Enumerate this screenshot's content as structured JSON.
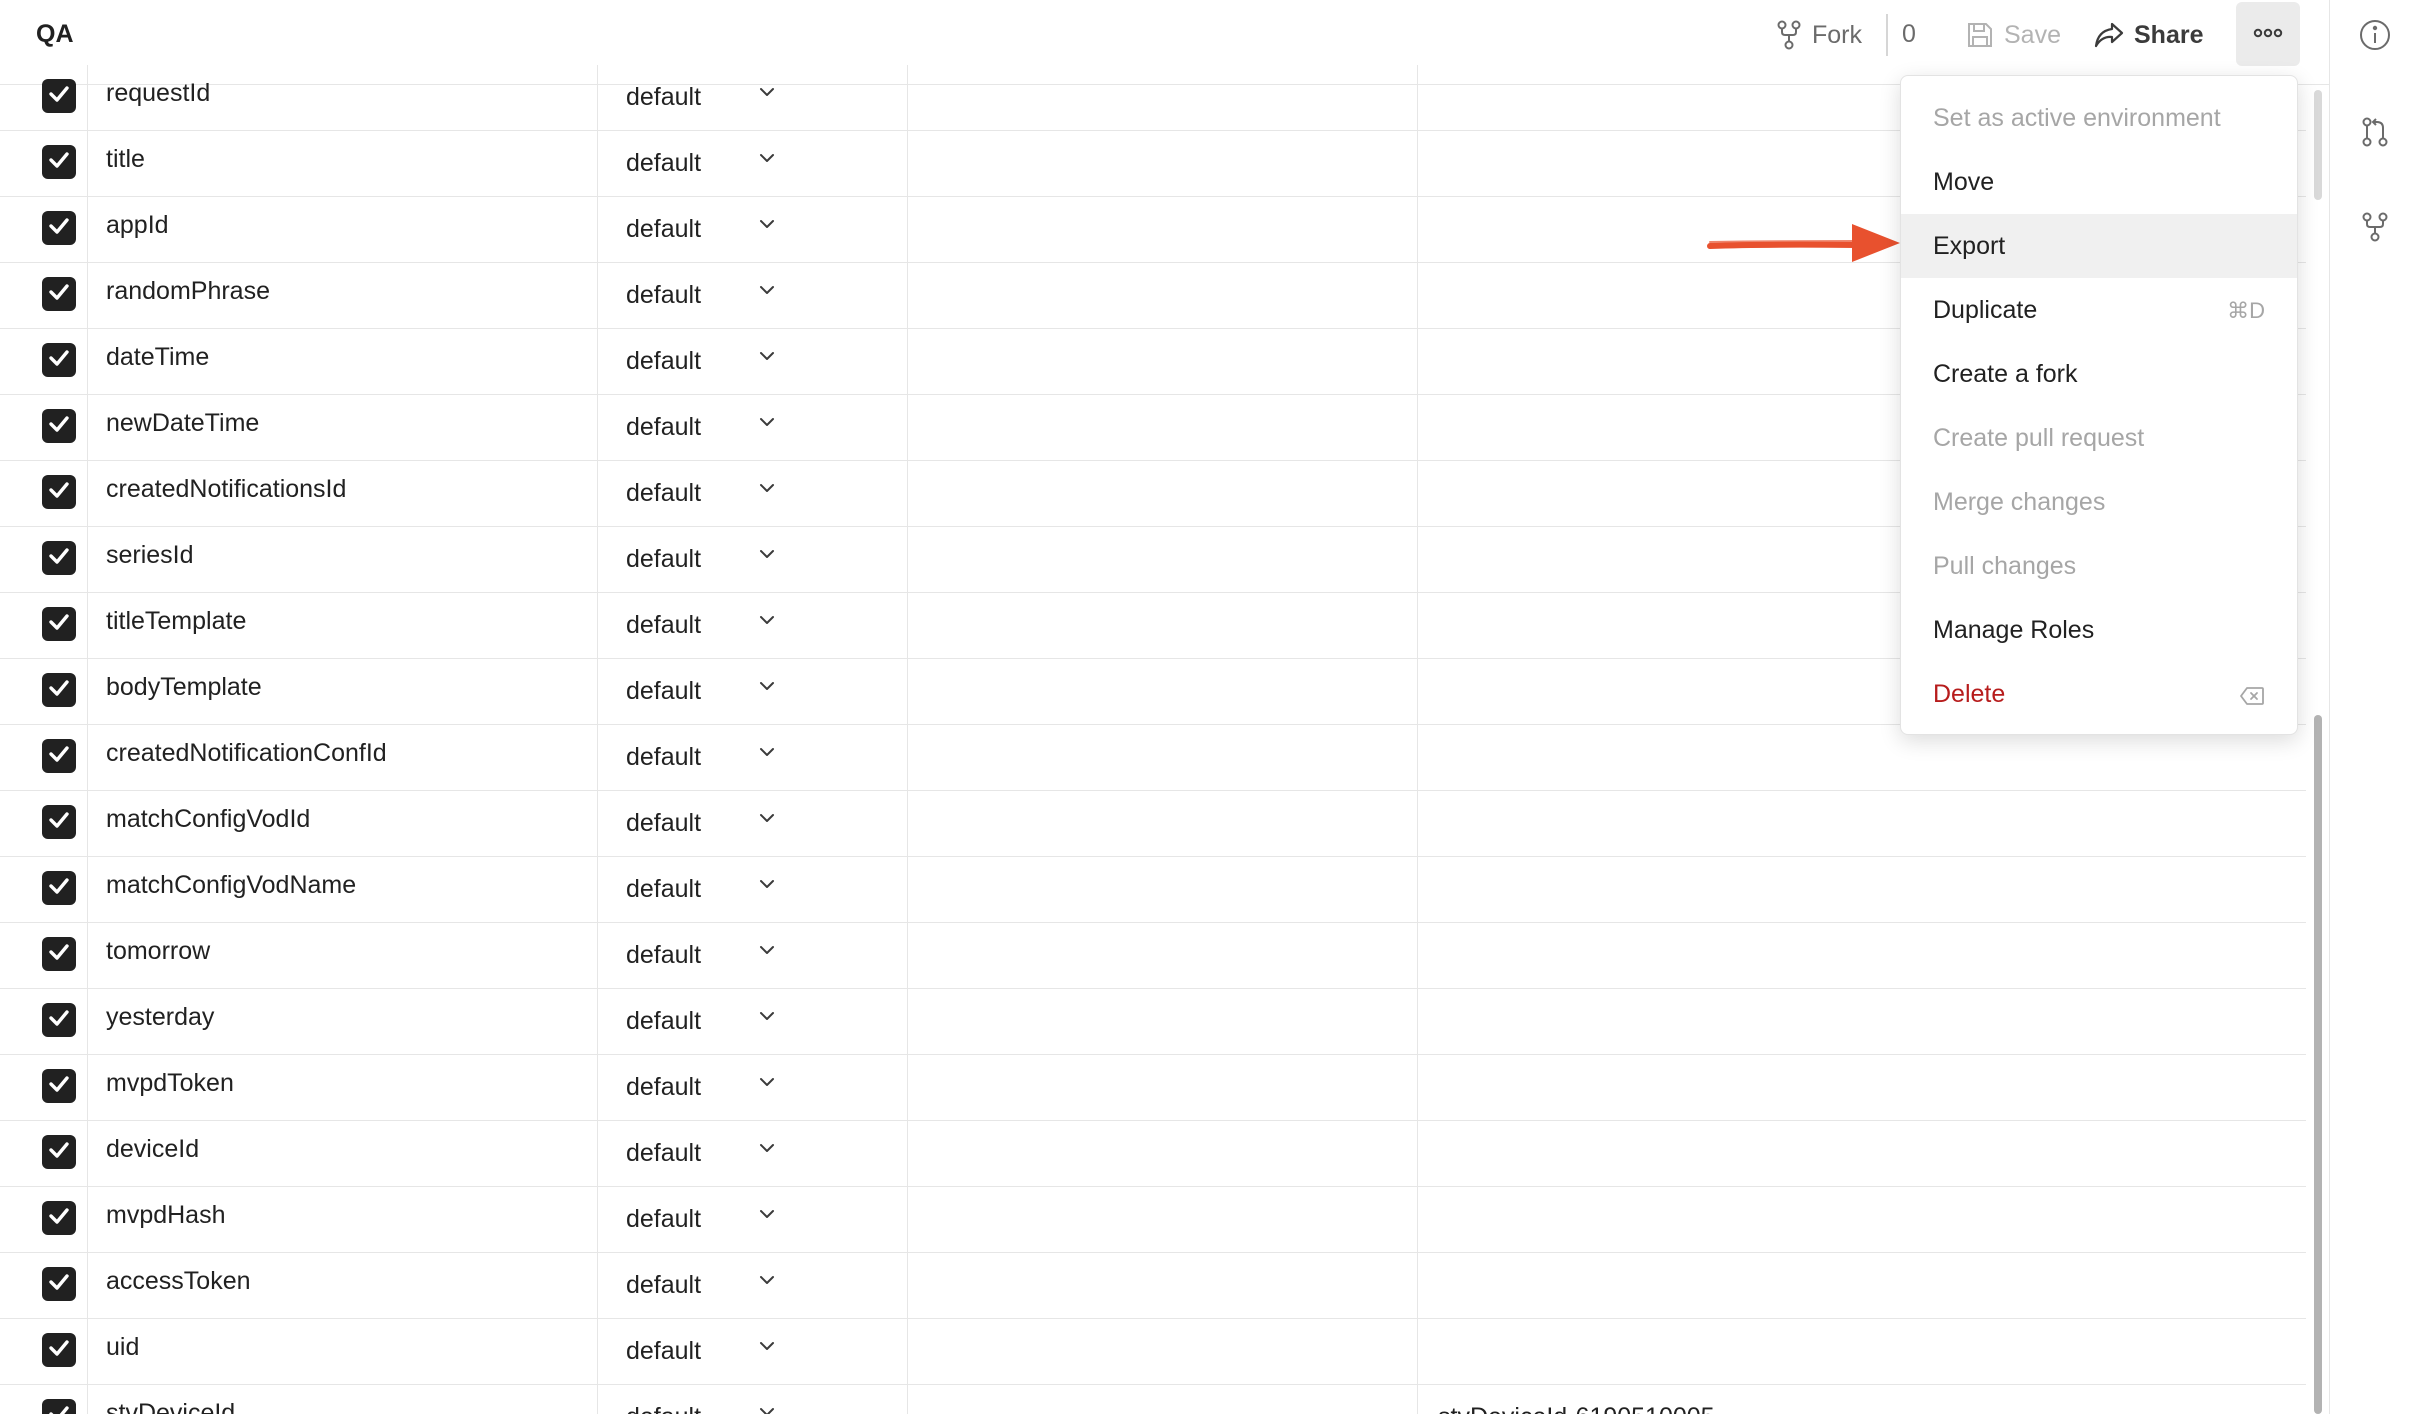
{
  "header": {
    "title": "QA",
    "fork_label": "Fork",
    "fork_count": "0",
    "save_label": "Save",
    "share_label": "Share"
  },
  "table": {
    "type_default": "default",
    "rows": [
      {
        "key": "requestId",
        "type": "default",
        "current": ""
      },
      {
        "key": "title",
        "type": "default",
        "current": ""
      },
      {
        "key": "appId",
        "type": "default",
        "current": ""
      },
      {
        "key": "randomPhrase",
        "type": "default",
        "current": ""
      },
      {
        "key": "dateTime",
        "type": "default",
        "current": ""
      },
      {
        "key": "newDateTime",
        "type": "default",
        "current": ""
      },
      {
        "key": "createdNotificationsId",
        "type": "default",
        "current": ""
      },
      {
        "key": "seriesId",
        "type": "default",
        "current": ""
      },
      {
        "key": "titleTemplate",
        "type": "default",
        "current": ""
      },
      {
        "key": "bodyTemplate",
        "type": "default",
        "current": ""
      },
      {
        "key": "createdNotificationConfId",
        "type": "default",
        "current": ""
      },
      {
        "key": "matchConfigVodId",
        "type": "default",
        "current": ""
      },
      {
        "key": "matchConfigVodName",
        "type": "default",
        "current": ""
      },
      {
        "key": "tomorrow",
        "type": "default",
        "current": ""
      },
      {
        "key": "yesterday",
        "type": "default",
        "current": ""
      },
      {
        "key": "mvpdToken",
        "type": "default",
        "current": ""
      },
      {
        "key": "deviceId",
        "type": "default",
        "current": ""
      },
      {
        "key": "mvpdHash",
        "type": "default",
        "current": ""
      },
      {
        "key": "accessToken",
        "type": "default",
        "current": ""
      },
      {
        "key": "uid",
        "type": "default",
        "current": ""
      },
      {
        "key": "stvDeviceId",
        "type": "default",
        "current": "stvDeviceId-6190510005"
      }
    ]
  },
  "menu": {
    "items": [
      {
        "label": "Set as active environment",
        "state": "disabled"
      },
      {
        "label": "Move",
        "state": "normal"
      },
      {
        "label": "Export",
        "state": "active"
      },
      {
        "label": "Duplicate",
        "state": "normal",
        "shortcut": "⌘D"
      },
      {
        "label": "Create a fork",
        "state": "normal"
      },
      {
        "label": "Create pull request",
        "state": "disabled"
      },
      {
        "label": "Merge changes",
        "state": "disabled"
      },
      {
        "label": "Pull changes",
        "state": "disabled"
      },
      {
        "label": "Manage Roles",
        "state": "normal"
      },
      {
        "label": "Delete",
        "state": "danger"
      }
    ]
  },
  "colors": {
    "accent_annotation": "#e8512e",
    "danger": "#b71c1c",
    "checkbox": "#212121"
  },
  "icons": [
    "fork-icon",
    "save-icon",
    "share-icon",
    "more-icon",
    "info-icon",
    "pull-request-icon",
    "fork-sidebar-icon",
    "checkbox-check-icon",
    "chevron-down-icon",
    "delete-key-icon",
    "annotation-arrow-icon"
  ]
}
